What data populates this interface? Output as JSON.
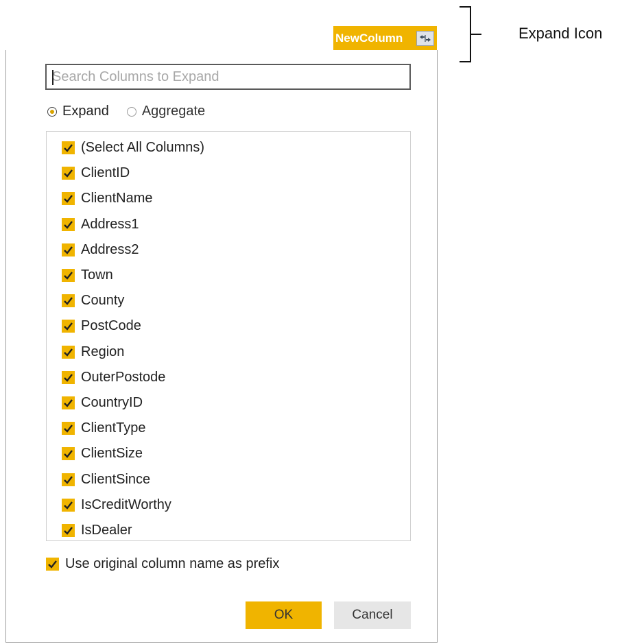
{
  "column_header": {
    "title": "NewColumn",
    "expand_icon": "expand-arrows-icon"
  },
  "annotation": {
    "label": "Expand Icon"
  },
  "dialog": {
    "search": {
      "placeholder": "Search Columns to Expand",
      "value": ""
    },
    "mode": {
      "selected": "Expand",
      "options": [
        {
          "label": "Expand",
          "selected": true
        },
        {
          "label": "Aggregate",
          "selected": false
        }
      ]
    },
    "columns": [
      {
        "label": "(Select All Columns)",
        "checked": true
      },
      {
        "label": "ClientID",
        "checked": true
      },
      {
        "label": "ClientName",
        "checked": true
      },
      {
        "label": "Address1",
        "checked": true
      },
      {
        "label": "Address2",
        "checked": true
      },
      {
        "label": "Town",
        "checked": true
      },
      {
        "label": "County",
        "checked": true
      },
      {
        "label": "PostCode",
        "checked": true
      },
      {
        "label": "Region",
        "checked": true
      },
      {
        "label": "OuterPostode",
        "checked": true
      },
      {
        "label": "CountryID",
        "checked": true
      },
      {
        "label": "ClientType",
        "checked": true
      },
      {
        "label": "ClientSize",
        "checked": true
      },
      {
        "label": "ClientSince",
        "checked": true
      },
      {
        "label": "IsCreditWorthy",
        "checked": true
      },
      {
        "label": "IsDealer",
        "checked": true
      }
    ],
    "prefix_option": {
      "label": "Use original column name as prefix",
      "checked": true
    },
    "buttons": {
      "ok": "OK",
      "cancel": "Cancel"
    }
  },
  "colors": {
    "accent": "#f0b400",
    "cancel_bg": "#e6e6e6",
    "header_text": "#ffffff"
  }
}
